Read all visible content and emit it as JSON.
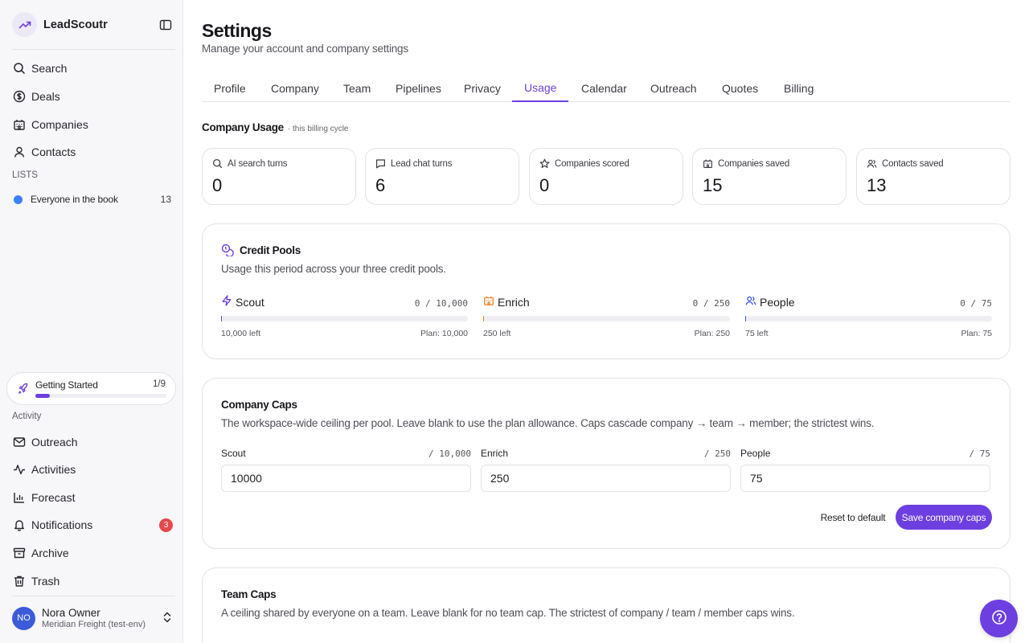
{
  "app": {
    "name": "LeadScoutr"
  },
  "sidebar": {
    "nav": [
      {
        "label": "Search",
        "icon": "search-icon"
      },
      {
        "label": "Deals",
        "icon": "dollar-icon"
      },
      {
        "label": "Companies",
        "icon": "building-icon"
      },
      {
        "label": "Contacts",
        "icon": "user-icon"
      }
    ],
    "lists_label": "LISTS",
    "lists": [
      {
        "label": "Everyone in the book",
        "count": "13",
        "color": "#3b82f6"
      }
    ],
    "getting_started": {
      "title": "Getting Started",
      "progress": "1/9",
      "fraction": 0.111
    },
    "activity_label": "Activity",
    "activity": [
      {
        "label": "Outreach",
        "icon": "mail-icon"
      },
      {
        "label": "Activities",
        "icon": "activity-icon"
      },
      {
        "label": "Forecast",
        "icon": "chart-icon"
      },
      {
        "label": "Notifications",
        "icon": "bell-icon",
        "badge": "3"
      },
      {
        "label": "Archive",
        "icon": "archive-icon"
      },
      {
        "label": "Trash",
        "icon": "trash-icon"
      }
    ],
    "user": {
      "initials": "NO",
      "name": "Nora Owner",
      "org": "Meridian Freight (test-env)"
    }
  },
  "header": {
    "title": "Settings",
    "subtitle": "Manage your account and company settings"
  },
  "tabs": [
    {
      "label": "Profile"
    },
    {
      "label": "Company"
    },
    {
      "label": "Team"
    },
    {
      "label": "Pipelines"
    },
    {
      "label": "Privacy"
    },
    {
      "label": "Usage",
      "active": true
    },
    {
      "label": "Calendar"
    },
    {
      "label": "Outreach"
    },
    {
      "label": "Quotes"
    },
    {
      "label": "Billing"
    }
  ],
  "usage": {
    "title": "Company Usage",
    "note": "· this billing cycle",
    "stats": [
      {
        "label": "AI search turns",
        "value": "0",
        "icon": "search-icon"
      },
      {
        "label": "Lead chat turns",
        "value": "6",
        "icon": "chat-icon"
      },
      {
        "label": "Companies scored",
        "value": "0",
        "icon": "star-icon"
      },
      {
        "label": "Companies saved",
        "value": "15",
        "icon": "building-icon"
      },
      {
        "label": "Contacts saved",
        "value": "13",
        "icon": "users-icon"
      }
    ]
  },
  "credit_pools": {
    "title": "Credit Pools",
    "description": "Usage this period across your three credit pools.",
    "pools": [
      {
        "name": "Scout",
        "usage": "0 / 10,000",
        "left": "10,000 left",
        "plan": "Plan: 10,000",
        "fraction": 0.0,
        "icon": "bolt-icon",
        "color": "#6d3fe0"
      },
      {
        "name": "Enrich",
        "usage": "0 / 250",
        "left": "250 left",
        "plan": "Plan: 250",
        "fraction": 0.0,
        "icon": "building-icon",
        "color": "#e8832a"
      },
      {
        "name": "People",
        "usage": "0 / 75",
        "left": "75 left",
        "plan": "Plan: 75",
        "fraction": 0.0,
        "icon": "users-icon",
        "color": "#3b5bd9"
      }
    ]
  },
  "company_caps": {
    "title": "Company Caps",
    "description": "The workspace-wide ceiling per pool. Leave blank to use the plan allowance. Caps cascade company → team → member; the strictest wins.",
    "fields": [
      {
        "label": "Scout",
        "max": "/ 10,000",
        "value": "10000"
      },
      {
        "label": "Enrich",
        "max": "/ 250",
        "value": "250"
      },
      {
        "label": "People",
        "max": "/ 75",
        "value": "75"
      }
    ],
    "reset_label": "Reset to default",
    "save_label": "Save company caps"
  },
  "team_caps": {
    "title": "Team Caps",
    "description": "A ceiling shared by everyone on a team. Leave blank for no team cap. The strictest of company / team / member caps wins."
  },
  "colors": {
    "accent": "#6d3fe0",
    "danger": "#e5484d",
    "list_blue": "#3b82f6"
  }
}
